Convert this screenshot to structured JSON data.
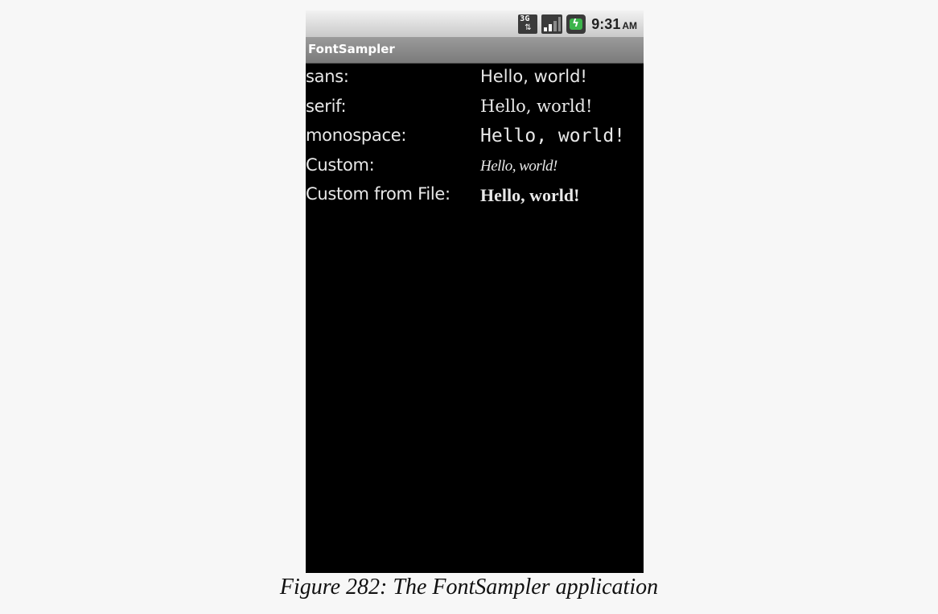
{
  "status_bar": {
    "network_label": "3G",
    "time": "9:31",
    "ampm": "AM",
    "icons": [
      "network-3g-icon",
      "signal-strength-icon",
      "battery-charging-icon"
    ]
  },
  "app": {
    "title": "FontSampler"
  },
  "rows": [
    {
      "label": "sans:",
      "sample": "Hello, world!"
    },
    {
      "label": "serif:",
      "sample": "Hello, world!"
    },
    {
      "label": "monospace:",
      "sample": "Hello, world!"
    },
    {
      "label": "Custom:",
      "sample": "Hello, world!"
    },
    {
      "label": "Custom from File:",
      "sample": "Hello, world!"
    }
  ],
  "caption": "Figure 282: The FontSampler application",
  "colors": {
    "screen_background": "#000000",
    "text": "#e8e8e8",
    "page_background": "#f7f7f7",
    "battery_green": "#3cb44b"
  }
}
